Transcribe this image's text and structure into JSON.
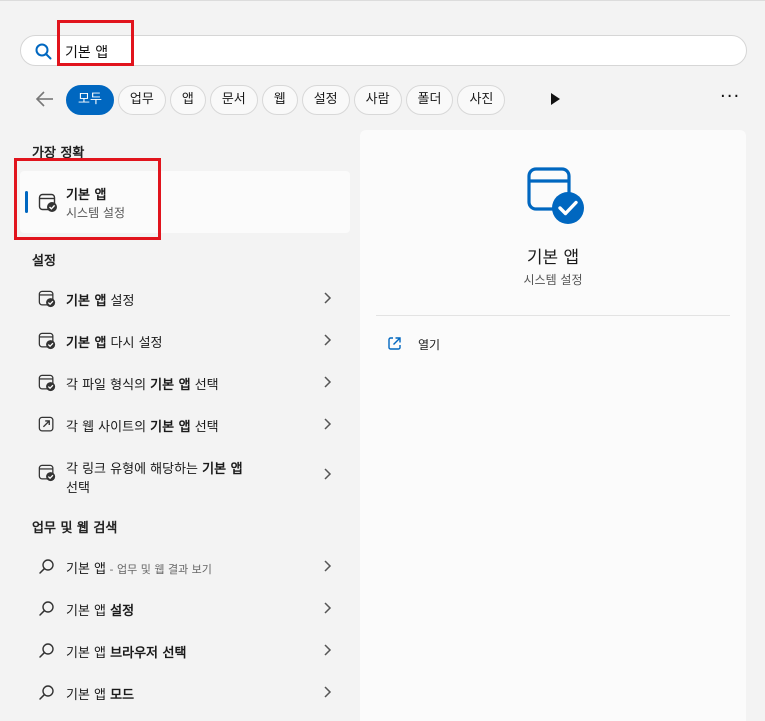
{
  "search": {
    "value": "기본 앱"
  },
  "filters": {
    "chips": [
      "모두",
      "업무",
      "앱",
      "문서",
      "웹",
      "설정",
      "사람",
      "폴더",
      "사진"
    ]
  },
  "best_match": {
    "header": "가장 정확",
    "title": "기본 앱",
    "subtitle": "시스템 설정"
  },
  "settings": {
    "header": "설정",
    "items": [
      {
        "pre": "",
        "bold": "기본 앱",
        "post": " 설정",
        "line2": "",
        "icon": "default-apps-icon"
      },
      {
        "pre": "",
        "bold": "기본 앱",
        "post": " 다시 설정",
        "line2": "",
        "icon": "default-apps-icon"
      },
      {
        "pre": "각 파일 형식의 ",
        "bold": "기본 앱",
        "post": " 선택",
        "line2": "",
        "icon": "default-apps-icon"
      },
      {
        "pre": "각 웹 사이트의 ",
        "bold": "기본 앱",
        "post": " 선택",
        "line2": "",
        "icon": "open-link-icon"
      },
      {
        "pre": "각 링크 유형에 해당하는 ",
        "bold": "기본 앱",
        "post": "",
        "line2": "선택",
        "icon": "default-apps-icon"
      }
    ]
  },
  "web_search": {
    "header": "업무 및 웹 검색",
    "items": [
      {
        "pre": "기본 앱",
        "bold": "",
        "sub": " - 업무 및 웹 결과 보기"
      },
      {
        "pre": "기본 앱 ",
        "bold": "설정",
        "sub": ""
      },
      {
        "pre": "기본 앱 ",
        "bold": "브라우저 선택",
        "sub": ""
      },
      {
        "pre": "기본 앱 ",
        "bold": "모드",
        "sub": ""
      }
    ]
  },
  "preview": {
    "title": "기본 앱",
    "subtitle": "시스템 설정",
    "open_label": "열기"
  },
  "colors": {
    "accent": "#0067c0",
    "highlight_box": "#e1141d"
  }
}
